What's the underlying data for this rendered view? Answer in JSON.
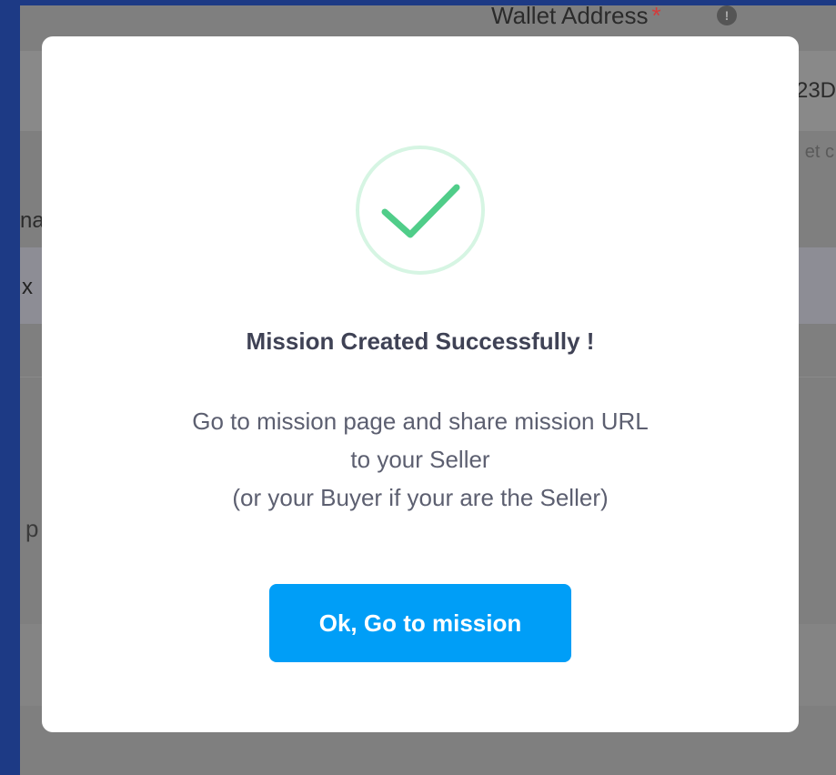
{
  "background": {
    "wallet_label": "Wallet Address",
    "required_mark": "*",
    "info_icon": "info-icon",
    "address_fragment": "23D",
    "hint_fragment": "et c",
    "name_fragment": "na",
    "row_fragment": "x",
    "p_fragment": "p"
  },
  "modal": {
    "icon": "check-circle-icon",
    "icon_color": "#50cd89",
    "title": "Mission Created Successfully !",
    "message_lines": [
      "Go to mission page and share mission URL",
      "to your Seller",
      "(or your Buyer if your are the Seller)"
    ],
    "button_label": "Ok, Go to mission",
    "button_color": "#009ef7"
  }
}
